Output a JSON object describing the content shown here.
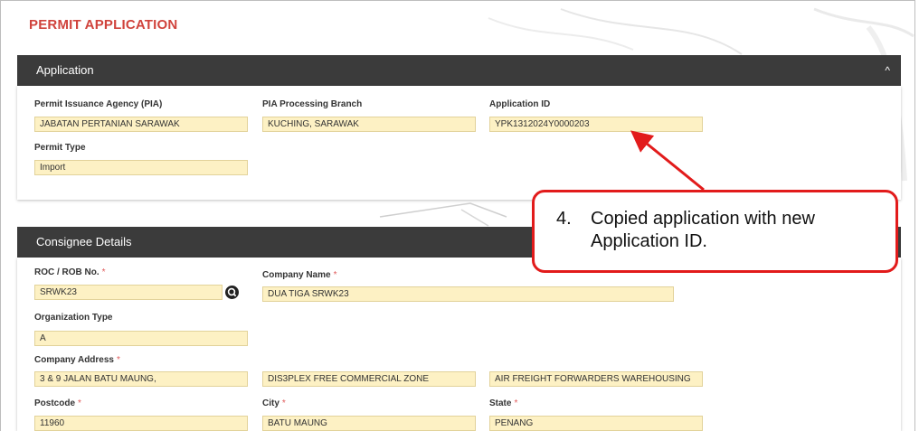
{
  "page": {
    "title": "PERMIT APPLICATION"
  },
  "application": {
    "header": "Application",
    "collapse_icon": "chevron-up-icon",
    "pia_label": "Permit Issuance Agency (PIA)",
    "pia_value": "JABATAN PERTANIAN SARAWAK",
    "branch_label": "PIA Processing Branch",
    "branch_value": "KUCHING, SARAWAK",
    "app_id_label": "Application ID",
    "app_id_value": "YPK1312024Y0000203",
    "permit_type_label": "Permit Type",
    "permit_type_value": "Import"
  },
  "consignee": {
    "header": "Consignee Details",
    "roc_label": "ROC / ROB No.",
    "roc_value": "SRWK23",
    "company_name_label": "Company Name",
    "company_name_value": "DUA TIGA SRWK23",
    "org_type_label": "Organization Type",
    "org_type_value": "A",
    "address_label": "Company Address",
    "address_line1": "3 & 9 JALAN BATU MAUNG,",
    "address_line2": "DIS3PLEX FREE COMMERCIAL ZONE",
    "address_line3": "AIR FREIGHT FORWARDERS WAREHOUSING",
    "postcode_label": "Postcode",
    "postcode_value": "11960",
    "city_label": "City",
    "city_value": "BATU MAUNG",
    "state_label": "State",
    "state_value": "PENANG",
    "required_mark": "*",
    "search_icon": "search-icon"
  },
  "annotation": {
    "number": "4.",
    "text": "Copied application with new Application ID."
  },
  "colors": {
    "title": "#d0433c",
    "header_bg": "#3b3b3b",
    "field_bg": "#fdf1c4",
    "annotation": "#e21b1b"
  }
}
